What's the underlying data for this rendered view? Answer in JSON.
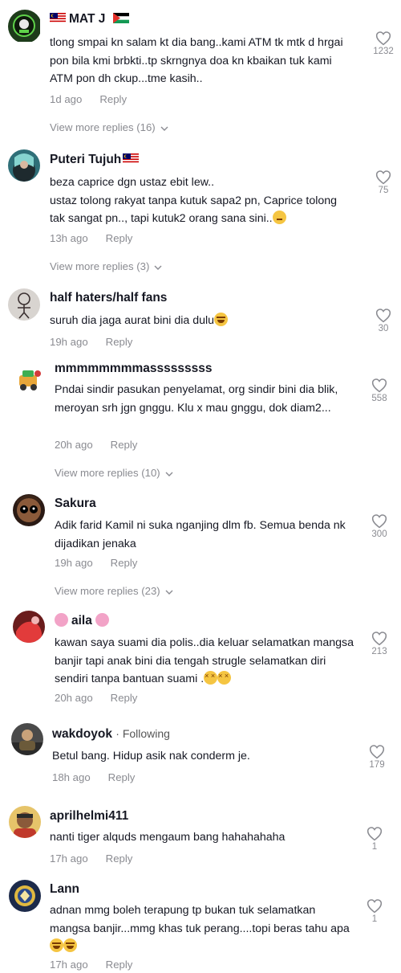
{
  "comments": [
    {
      "username": "MAT J",
      "text": "tlong smpai kn salam kt dia bang..kami ATM tk mtk d hrgai pon bila kmi brbkti..tp skrngnya doa kn kbaikan tuk kami ATM pon dh ckup...tme kasih..",
      "time": "1d ago",
      "reply": "Reply",
      "likes": "1232",
      "view_more": "View more replies (16)"
    },
    {
      "username": "Puteri Tujuh",
      "text": "beza caprice dgn ustaz ebit lew..\nustaz tolong rakyat tanpa kutuk sapa2 pn, Caprice tolong tak sangat pn.., tapi kutuk2 orang sana sini..",
      "time": "13h ago",
      "reply": "Reply",
      "likes": "75",
      "view_more": "View more replies (3)"
    },
    {
      "username": "half haters/half fans",
      "text": "suruh dia jaga aurat bini dia dulu",
      "time": "19h ago",
      "reply": "Reply",
      "likes": "30"
    },
    {
      "username": "mmmmmmmmasssssssss",
      "text": "Pndai sindir pasukan penyelamat, org sindir bini dia blik, meroyan srh jgn gnggu. Klu x mau gnggu, dok diam2...",
      "time": "20h ago",
      "reply": "Reply",
      "likes": "558",
      "view_more": "View more replies (10)"
    },
    {
      "username": "Sakura",
      "text": "Adik farid Kamil ni suka nganjing dlm fb. Semua benda nk dijadikan jenaka",
      "time": "19h ago",
      "reply": "Reply",
      "likes": "300",
      "view_more": "View more replies (23)"
    },
    {
      "username": "aila",
      "text": "kawan saya suami dia polis..dia keluar selamatkan mangsa banjir tapi anak bini dia tengah strugle selamatkan diri sendiri tanpa bantuan suami .",
      "time": "20h ago",
      "reply": "Reply",
      "likes": "213"
    },
    {
      "username": "wakdoyok",
      "following": "· Following",
      "text": "Betul bang. Hidup asik nak conderm je.",
      "time": "18h ago",
      "reply": "Reply",
      "likes": "179"
    },
    {
      "username": "aprilhelmi411",
      "text": "nanti tiger alquds mengaum bang hahahahaha",
      "time": "17h ago",
      "reply": "Reply",
      "likes": "1"
    },
    {
      "username": "Lann",
      "text": "adnan mmg boleh terapung tp bukan tuk selamatkan mangsa banjir...mmg khas tuk perang....topi beras tahu apa",
      "time": "17h ago",
      "reply": "Reply",
      "likes": "1"
    }
  ],
  "icons": {
    "like": "heart-outline-icon",
    "chevron": "chevron-down-icon"
  },
  "colors": {
    "text": "#161823",
    "muted": "#8a8b91"
  }
}
